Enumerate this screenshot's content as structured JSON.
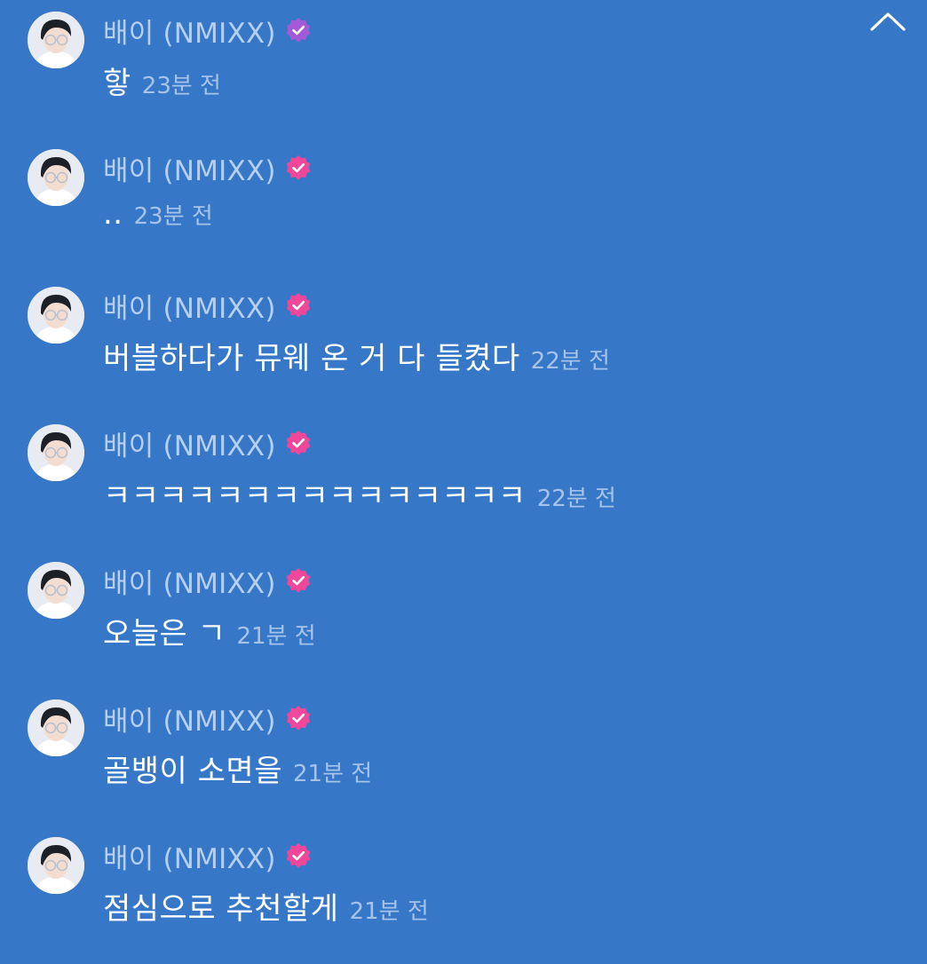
{
  "colors": {
    "background": "#3678c7",
    "name": "#b7cff0",
    "message": "#ffffff",
    "timestamp": "#a7c3ea",
    "badge_first": "#a45ad6",
    "badge": "#f0479b"
  },
  "controls": {
    "collapse_icon": "chevron-up-icon"
  },
  "messages": [
    {
      "author": "배이 (NMIXX)",
      "text": "핳",
      "time": "23분 전",
      "badge_icon": "verified-badge-icon"
    },
    {
      "author": "배이 (NMIXX)",
      "text": "..",
      "time": "23분 전",
      "badge_icon": "verified-badge-icon"
    },
    {
      "author": "배이 (NMIXX)",
      "text": "버블하다가 뮤웨 온 거 다 들켰다",
      "time": "22분 전",
      "badge_icon": "verified-badge-icon"
    },
    {
      "author": "배이 (NMIXX)",
      "text": "ㅋㅋㅋㅋㅋㅋㅋㅋㅋㅋㅋㅋㅋㅋㅋ",
      "time": "22분 전",
      "badge_icon": "verified-badge-icon"
    },
    {
      "author": "배이 (NMIXX)",
      "text": "오늘은 ㄱ",
      "time": "21분 전",
      "badge_icon": "verified-badge-icon"
    },
    {
      "author": "배이 (NMIXX)",
      "text": "골뱅이 소면을",
      "time": "21분 전",
      "badge_icon": "verified-badge-icon"
    },
    {
      "author": "배이 (NMIXX)",
      "text": "점심으로 추천할게",
      "time": "21분 전",
      "badge_icon": "verified-badge-icon"
    }
  ]
}
